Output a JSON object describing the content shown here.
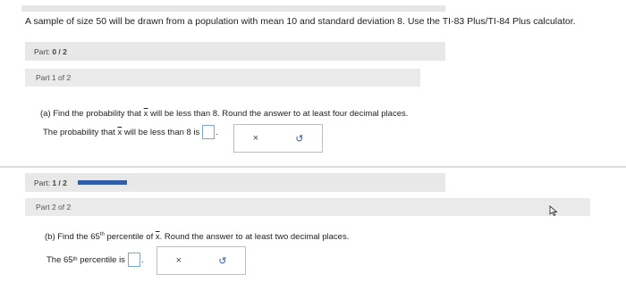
{
  "question": "A sample of size 50 will be drawn from a population with mean 10 and standard deviation 8. Use the TI-83 Plus/TI-84 Plus calculator.",
  "part1_bar": {
    "label": "Part:",
    "value": "0 / 2"
  },
  "part1_section": {
    "label": "Part 1 of 2"
  },
  "part1_question": {
    "text_a": "(a) Find the probability that",
    "var": "x",
    "text_b": "will be less than 8. Round the answer to at least four decimal places."
  },
  "part1_answer": {
    "text_a": "The probability that",
    "var": "x",
    "text_b": "will be less than 8 is",
    "value": ""
  },
  "part2_bar": {
    "label": "Part:",
    "value": "1 / 2",
    "progress": 0.5
  },
  "part2_section": {
    "label": "Part 2 of 2"
  },
  "part2_question": {
    "text_a": "(b) Find the 65",
    "sup": "th",
    "text_b": "percentile of",
    "var": "x",
    "text_c": ". Round the answer to at least two decimal places."
  },
  "part2_answer": {
    "text_a": "The 65",
    "sup": "th",
    "text_b": "percentile is",
    "value": ""
  },
  "tools": {
    "clear_symbol": "×",
    "undo_symbol": "↺"
  },
  "colors": {
    "progress": "#2f5fa8",
    "input_border": "#7aa7d6",
    "bar_bg": "#e8e8e8"
  }
}
